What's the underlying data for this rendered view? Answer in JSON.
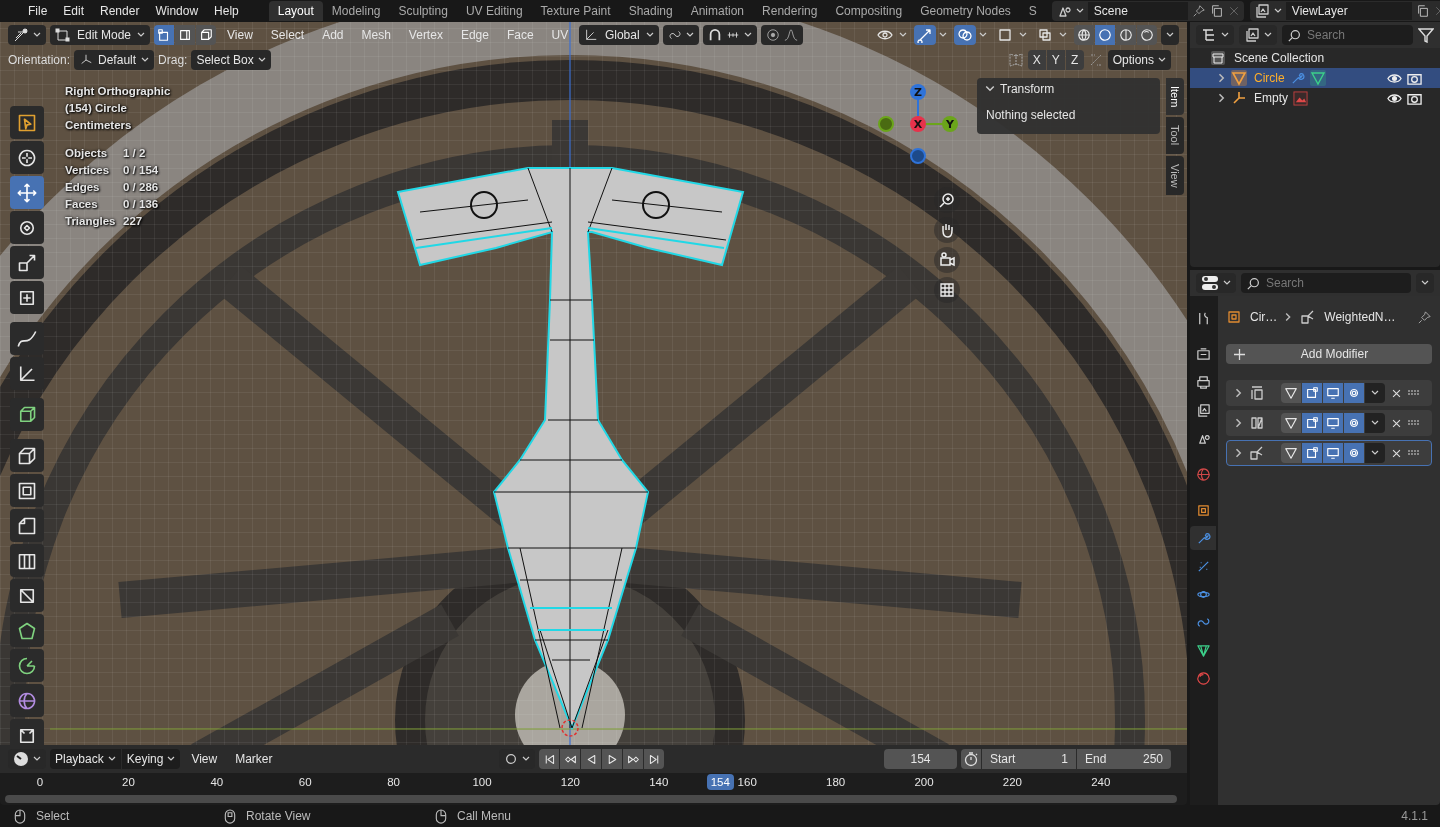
{
  "menu": [
    "File",
    "Edit",
    "Render",
    "Window",
    "Help"
  ],
  "workspaces": [
    {
      "label": "Layout",
      "selected": true
    },
    {
      "label": "Modeling",
      "selected": false
    },
    {
      "label": "Sculpting",
      "selected": false
    },
    {
      "label": "UV Editing",
      "selected": false
    },
    {
      "label": "Texture Paint",
      "selected": false
    },
    {
      "label": "Shading",
      "selected": false
    },
    {
      "label": "Animation",
      "selected": false
    },
    {
      "label": "Rendering",
      "selected": false
    },
    {
      "label": "Compositing",
      "selected": false
    },
    {
      "label": "Geometry Nodes",
      "selected": false
    },
    {
      "label": "S",
      "selected": false
    }
  ],
  "scene": "Scene",
  "view_layer": "ViewLayer",
  "viewport_header": {
    "mode": "Edit Mode",
    "select_modes": [
      {
        "kind": "vertex",
        "selected": true
      },
      {
        "kind": "edge",
        "selected": false
      },
      {
        "kind": "face",
        "selected": false
      }
    ],
    "menus": [
      "View",
      "Select",
      "Add",
      "Mesh",
      "Vertex",
      "Edge",
      "Face",
      "UV"
    ],
    "orientation": "Global",
    "toggles": [
      {
        "kind": "visibility",
        "on": false
      },
      {
        "kind": "gizmos",
        "on": true
      },
      {
        "kind": "overlays",
        "on": true
      },
      {
        "kind": "mesh-overlay",
        "on": false
      },
      {
        "kind": "xray",
        "on": false
      }
    ],
    "shading": [
      {
        "kind": "wireframe",
        "selected": false
      },
      {
        "kind": "solid",
        "selected": true
      },
      {
        "kind": "material",
        "selected": false
      },
      {
        "kind": "rendered",
        "selected": false
      }
    ]
  },
  "tool_settings": {
    "orientation_label": "Orientation:",
    "orientation": "Default",
    "drag_label": "Drag:",
    "drag": "Select Box",
    "axes": [
      "X",
      "Y",
      "Z"
    ],
    "options": "Options"
  },
  "overlay_info": {
    "view": "Right Orthographic",
    "object": "(154) Circle",
    "units": "Centimeters",
    "stats": [
      {
        "label": "Objects",
        "value": "1 / 2"
      },
      {
        "label": "Vertices",
        "value": "0 / 154"
      },
      {
        "label": "Edges",
        "value": "0 / 286"
      },
      {
        "label": "Faces",
        "value": "0 / 136"
      },
      {
        "label": "Triangles",
        "value": "227"
      }
    ]
  },
  "toolbar": [
    {
      "kind": "select-box",
      "selected": false
    },
    {
      "kind": "cursor",
      "selected": false
    },
    {
      "kind": "move",
      "selected": true
    },
    {
      "kind": "rotate",
      "selected": false
    },
    {
      "kind": "scale",
      "selected": false
    },
    {
      "kind": "transform",
      "selected": false
    },
    {
      "kind": "annotate",
      "selected": false
    },
    {
      "kind": "measure",
      "selected": false
    },
    {
      "kind": "add-cube",
      "selected": false
    },
    {
      "kind": "extrude",
      "selected": false
    },
    {
      "kind": "inset",
      "selected": false
    },
    {
      "kind": "bevel",
      "selected": false
    },
    {
      "kind": "loop-cut",
      "selected": false
    },
    {
      "kind": "knife",
      "selected": false
    },
    {
      "kind": "poly-build",
      "selected": false
    },
    {
      "kind": "spin",
      "selected": false
    },
    {
      "kind": "smooth",
      "selected": false
    },
    {
      "kind": "shrink",
      "selected": false
    }
  ],
  "gizmo_axes": [
    {
      "label": "Z",
      "color": "#2f73d9"
    },
    {
      "label": "X",
      "color": "#e6324b"
    },
    {
      "label": "Y",
      "color": "#6ba51a"
    }
  ],
  "sidebar": {
    "panel_title": "Transform",
    "message": "Nothing selected",
    "tabs": [
      {
        "label": "Item",
        "selected": true
      },
      {
        "label": "Tool",
        "selected": false
      },
      {
        "label": "View",
        "selected": false
      }
    ]
  },
  "outliner": {
    "search_placeholder": "Search",
    "root": "Scene Collection",
    "items": [
      {
        "name": "Circle",
        "kind": "mesh",
        "selected": true
      },
      {
        "name": "Empty",
        "kind": "empty",
        "selected": false
      }
    ]
  },
  "properties": {
    "search_placeholder": "Search",
    "breadcrumb": [
      "Cir…",
      "WeightedN…"
    ],
    "add_modifier": "Add Modifier",
    "tabs": [
      {
        "kind": "tool",
        "selected": false
      },
      {
        "kind": "render",
        "selected": false
      },
      {
        "kind": "output",
        "selected": false
      },
      {
        "kind": "view-layer",
        "selected": false
      },
      {
        "kind": "scene",
        "selected": false
      },
      {
        "kind": "world",
        "selected": false
      },
      {
        "kind": "object",
        "selected": false
      },
      {
        "kind": "modifier",
        "selected": true
      },
      {
        "kind": "particles",
        "selected": false
      },
      {
        "kind": "physics",
        "selected": false
      },
      {
        "kind": "constraints",
        "selected": false
      },
      {
        "kind": "data",
        "selected": false
      },
      {
        "kind": "material",
        "selected": false
      }
    ],
    "modifiers": [
      {
        "kind": "solidify",
        "selected": false,
        "toggles": [
          {
            "kind": "edit-mode",
            "on": false
          },
          {
            "kind": "cage",
            "on": true
          },
          {
            "kind": "viewport",
            "on": true
          },
          {
            "kind": "render",
            "on": true
          }
        ]
      },
      {
        "kind": "mirror",
        "selected": false,
        "toggles": [
          {
            "kind": "edit-mode",
            "on": false
          },
          {
            "kind": "cage",
            "on": true
          },
          {
            "kind": "viewport",
            "on": true
          },
          {
            "kind": "render",
            "on": true
          }
        ]
      },
      {
        "kind": "weighted-normal",
        "selected": true,
        "toggles": [
          {
            "kind": "edit-mode",
            "on": false
          },
          {
            "kind": "cage",
            "on": true
          },
          {
            "kind": "viewport",
            "on": true
          },
          {
            "kind": "render",
            "on": true
          }
        ]
      }
    ]
  },
  "timeline": {
    "menus": [
      "Playback",
      "Keying",
      "View",
      "Marker"
    ],
    "current_frame": "154",
    "start_label": "Start",
    "start": "1",
    "end_label": "End",
    "end": "250",
    "transport": [
      {
        "kind": "jump-start"
      },
      {
        "kind": "prev-key"
      },
      {
        "kind": "play-reverse"
      },
      {
        "kind": "play"
      },
      {
        "kind": "next-key"
      },
      {
        "kind": "jump-end"
      }
    ],
    "ruler": [
      "0",
      "20",
      "40",
      "60",
      "80",
      "100",
      "120",
      "140",
      "160",
      "180",
      "200",
      "220",
      "240"
    ],
    "playhead": {
      "frame": "154",
      "level": 0.616
    }
  },
  "status_bar": {
    "hints": [
      "Select",
      "Rotate View",
      "Call Menu"
    ],
    "version": "4.1.1"
  }
}
